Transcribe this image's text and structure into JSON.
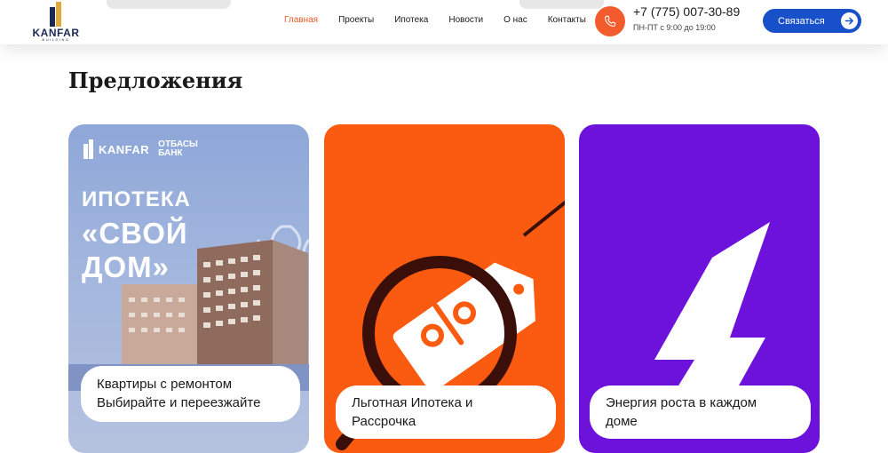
{
  "header": {
    "logo_text": "KANFAR",
    "logo_sub": "BUILDING",
    "nav": [
      {
        "label": "Главная",
        "active": true
      },
      {
        "label": "Проекты",
        "active": false
      },
      {
        "label": "Ипотека",
        "active": false
      },
      {
        "label": "Новости",
        "active": false
      },
      {
        "label": "О нас",
        "active": false
      },
      {
        "label": "Контакты",
        "active": false
      }
    ],
    "phone_icon": "phone-icon",
    "phone_number": "+7 (775) 007-30-89",
    "hours": "ПН-ПТ с 9:00 до 19:00",
    "contact_button": "Связаться",
    "contact_arrow_icon": "arrow-right-icon"
  },
  "main": {
    "section_title": "Предложения",
    "cards": [
      {
        "promo": {
          "logo_text": "KANFAR",
          "bank_line1": "ОТБАСЫ",
          "bank_line2": "БАНК",
          "title_line1": "ИПОТЕКА",
          "title_line2": "«СВОЙ",
          "title_line3": "ДОМ»"
        },
        "caption_line1": "Квартиры с ремонтом",
        "caption_line2": "Выбирайте и переезжайте"
      },
      {
        "illustration": "magnifier-percent-tag-icon",
        "caption_line1": "Льготная Ипотека и",
        "caption_line2": "Рассрочка"
      },
      {
        "illustration": "lightning-bolt-icon",
        "caption_line1": "Энергия роста в каждом",
        "caption_line2": "доме"
      }
    ]
  },
  "colors": {
    "accent_orange": "#f35b2c",
    "primary_blue": "#1750c9",
    "card_orange": "#fb5b10",
    "card_purple": "#6c12db"
  }
}
